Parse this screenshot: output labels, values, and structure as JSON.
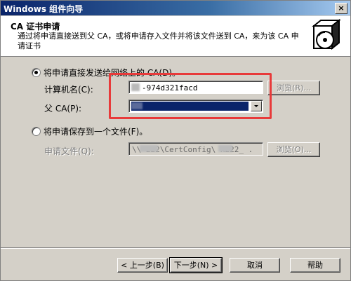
{
  "window": {
    "title": "Windows 组件向导",
    "close_glyph": "×"
  },
  "header": {
    "title": "CA 证书申请",
    "description": "通过将申请直接送到父 CA，或将申请存入文件并将该文件送到 CA，来为该 CA 申请证书",
    "icon": "wizard-disk-box-icon"
  },
  "options": {
    "direct": {
      "label": "将申请直接发送给网络上的 CA(D)。",
      "checked": true,
      "computer_label": "计算机名(C):",
      "computer_value": "-974d321facd",
      "browse_label": "浏览(R)...",
      "parent_label": "父 CA(P):"
    },
    "file": {
      "label": "将申请保存到一个文件(F)。",
      "checked": false,
      "file_label": "申请文件(Q):",
      "file_value": "\\\\    222\\CertConfig\\    x222_    .",
      "browse_label": "浏览(O)..."
    }
  },
  "buttons": {
    "back": "< 上一步(B)",
    "next": "下一步(N) >",
    "cancel": "取消",
    "help": "帮助"
  },
  "colors": {
    "title_start": "#0a246a",
    "selection": "#0a246a",
    "annotation": "#e83a3a"
  }
}
